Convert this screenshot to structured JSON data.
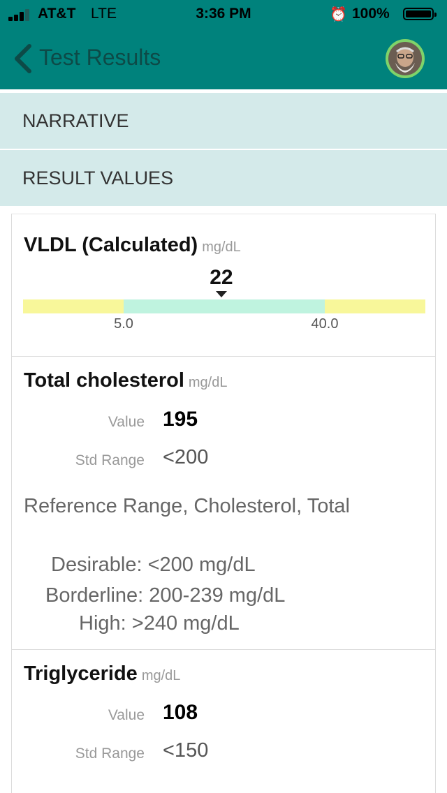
{
  "status_bar": {
    "carrier": "AT&T",
    "network": "LTE",
    "time": "3:36 PM",
    "battery": "100%"
  },
  "navbar": {
    "back_label": "Test Results",
    "accent_color": "#00827c"
  },
  "sections": {
    "narrative": "NARRATIVE",
    "result_values": "RESULT VALUES"
  },
  "results": [
    {
      "name": "VLDL (Calculated)",
      "unit": "mg/dL",
      "value": "22",
      "gauge": {
        "low": "5.0",
        "high": "40.0",
        "value_num": 22,
        "colors": {
          "out_of_range": "#f8f79a",
          "in_range": "#bff3df"
        }
      }
    },
    {
      "name": "Total cholesterol",
      "unit": "mg/dL",
      "value_label": "Value",
      "value": "195",
      "range_label": "Std Range",
      "range": "<200",
      "reference_title": "Reference Range, Cholesterol, Total",
      "reference_lines": [
        "Desirable: <200 mg/dL",
        "Borderline:  200-239 mg/dL",
        "High: >240 mg/dL"
      ]
    },
    {
      "name": "Triglyceride",
      "unit": "mg/dL",
      "value_label": "Value",
      "value": "108",
      "range_label": "Std Range",
      "range": "<150"
    }
  ]
}
